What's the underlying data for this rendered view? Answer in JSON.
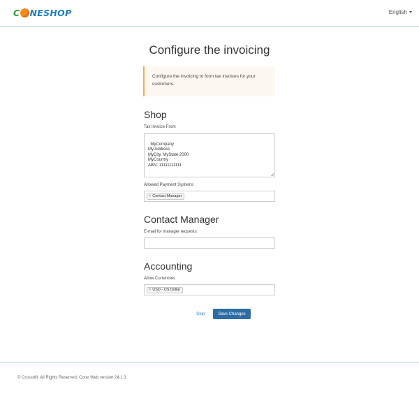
{
  "header": {
    "logo": {
      "left": "C",
      "right": "NESHOP"
    },
    "language": "English"
  },
  "page_title": "Configure the invoicing",
  "callout": "Configure the invoicing to form tax invoices for your customers.",
  "shop": {
    "heading": "Shop",
    "tax_invoice_label": "Tax Invoice From",
    "tax_invoice_value": "MyCompany\nMy Address\nMyCity, MyState 2000\nMyCountry\nABN: 11111111111",
    "payment_label": "Allowed Payment Systems",
    "payment_tag": "Contact Manager"
  },
  "contact": {
    "heading": "Contact Manager",
    "email_label": "E-mail for manager requests",
    "email_value": ""
  },
  "accounting": {
    "heading": "Accounting",
    "currency_label": "Allow Currencies",
    "currency_tag": "USD - US Dollar"
  },
  "actions": {
    "skip": "Skip",
    "save": "Save Changes"
  },
  "footer": "© Crossbill, All Rights Reserved, Cone Web version 24.1.3",
  "colors": {
    "brand_blue": "#1b7cc1",
    "brand_green": "#2f9a3e",
    "brand_orange": "#f28a1c",
    "primary_button": "#2e6da4",
    "callout_border": "#f0ad4e"
  }
}
